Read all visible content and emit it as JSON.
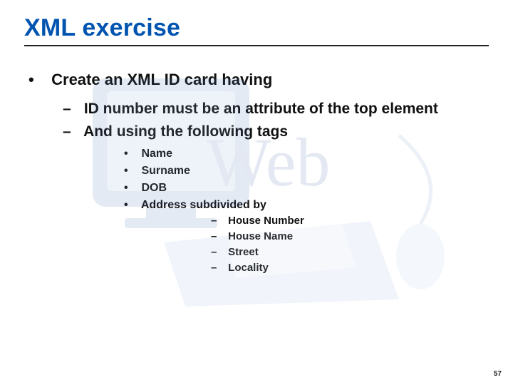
{
  "title": "XML exercise",
  "page_number": "57",
  "bullets": {
    "lvl1": [
      {
        "text": "Create an XML ID card having",
        "lvl2": [
          {
            "text": "ID number must be an attribute of the top element"
          },
          {
            "text": "And using the following tags",
            "lvl3": [
              {
                "text": "Name"
              },
              {
                "text": "Surname"
              },
              {
                "text": "DOB"
              },
              {
                "text": "Address subdivided by",
                "lvl4": [
                  {
                    "text": "House Number"
                  },
                  {
                    "text": "House Name"
                  },
                  {
                    "text": "Street"
                  },
                  {
                    "text": "Locality"
                  }
                ]
              }
            ]
          }
        ]
      }
    ]
  }
}
